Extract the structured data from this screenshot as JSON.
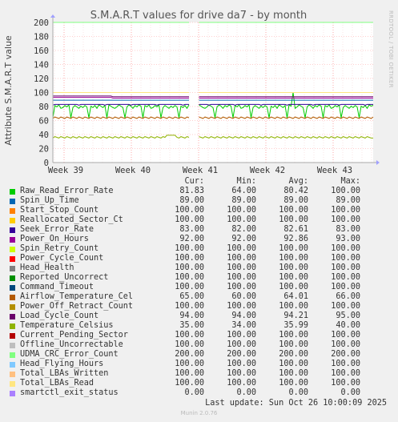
{
  "title": "S.M.A.R.T values for drive da7 - by month",
  "ylabel": "Attribute S.M.A.R.T value",
  "side_label": "RRDTOOL / TOBI OETIKER",
  "legend_header": {
    "cur": "Cur:",
    "min": "Min:",
    "avg": "Avg:",
    "max": "Max:"
  },
  "last_update": "Last update: Sun Oct 26 10:00:09 2025",
  "footer": "Munin 2.0.76",
  "chart_data": {
    "type": "line",
    "title": "S.M.A.R.T values for drive da7 - by month",
    "ylabel": "Attribute S.M.A.R.T value",
    "xlabel": "",
    "ylim": [
      0,
      200
    ],
    "yticks": [
      0,
      20,
      40,
      60,
      80,
      100,
      120,
      140,
      160,
      180,
      200
    ],
    "x_ticks": [
      "Week 39",
      "Week 40",
      "Week 41",
      "Week 42",
      "Week 43"
    ],
    "grid": true,
    "series": [
      {
        "name": "Raw_Read_Error_Rate",
        "color": "#00cc00",
        "cur": "81.83",
        "min": "64.00",
        "avg": "80.42",
        "max": "100.00"
      },
      {
        "name": "Spin_Up_Time",
        "color": "#0066b3",
        "cur": "89.00",
        "min": "89.00",
        "avg": "89.00",
        "max": "89.00"
      },
      {
        "name": "Start_Stop_Count",
        "color": "#ff8000",
        "cur": "100.00",
        "min": "100.00",
        "avg": "100.00",
        "max": "100.00"
      },
      {
        "name": "Reallocated_Sector_Ct",
        "color": "#ffcc00",
        "cur": "100.00",
        "min": "100.00",
        "avg": "100.00",
        "max": "100.00"
      },
      {
        "name": "Seek_Error_Rate",
        "color": "#330099",
        "cur": "83.00",
        "min": "82.00",
        "avg": "82.61",
        "max": "83.00"
      },
      {
        "name": "Power_On_Hours",
        "color": "#990099",
        "cur": "92.00",
        "min": "92.00",
        "avg": "92.86",
        "max": "93.00"
      },
      {
        "name": "Spin_Retry_Count",
        "color": "#ccff00",
        "cur": "100.00",
        "min": "100.00",
        "avg": "100.00",
        "max": "100.00"
      },
      {
        "name": "Power_Cycle_Count",
        "color": "#ff0000",
        "cur": "100.00",
        "min": "100.00",
        "avg": "100.00",
        "max": "100.00"
      },
      {
        "name": "Head_Health",
        "color": "#808080",
        "cur": "100.00",
        "min": "100.00",
        "avg": "100.00",
        "max": "100.00"
      },
      {
        "name": "Reported_Uncorrect",
        "color": "#008f00",
        "cur": "100.00",
        "min": "100.00",
        "avg": "100.00",
        "max": "100.00"
      },
      {
        "name": "Command_Timeout",
        "color": "#00487d",
        "cur": "100.00",
        "min": "100.00",
        "avg": "100.00",
        "max": "100.00"
      },
      {
        "name": "Airflow_Temperature_Cel",
        "color": "#b35a00",
        "cur": "65.00",
        "min": "60.00",
        "avg": "64.01",
        "max": "66.00"
      },
      {
        "name": "Power_Off_Retract_Count",
        "color": "#b38f00",
        "cur": "100.00",
        "min": "100.00",
        "avg": "100.00",
        "max": "100.00"
      },
      {
        "name": "Load_Cycle_Count",
        "color": "#6b006b",
        "cur": "94.00",
        "min": "94.00",
        "avg": "94.21",
        "max": "95.00"
      },
      {
        "name": "Temperature_Celsius",
        "color": "#8fb300",
        "cur": "35.00",
        "min": "34.00",
        "avg": "35.99",
        "max": "40.00"
      },
      {
        "name": "Current_Pending_Sector",
        "color": "#b30000",
        "cur": "100.00",
        "min": "100.00",
        "avg": "100.00",
        "max": "100.00"
      },
      {
        "name": "Offline_Uncorrectable",
        "color": "#bebebe",
        "cur": "100.00",
        "min": "100.00",
        "avg": "100.00",
        "max": "100.00"
      },
      {
        "name": "UDMA_CRC_Error_Count",
        "color": "#80ff80",
        "cur": "200.00",
        "min": "200.00",
        "avg": "200.00",
        "max": "200.00"
      },
      {
        "name": "Head_Flying_Hours",
        "color": "#80c9ff",
        "cur": "100.00",
        "min": "100.00",
        "avg": "100.00",
        "max": "100.00"
      },
      {
        "name": "Total_LBAs_Written",
        "color": "#ffc080",
        "cur": "100.00",
        "min": "100.00",
        "avg": "100.00",
        "max": "100.00"
      },
      {
        "name": "Total_LBAs_Read",
        "color": "#ffe680",
        "cur": "100.00",
        "min": "100.00",
        "avg": "100.00",
        "max": "100.00"
      },
      {
        "name": "smartctl_exit_status",
        "color": "#aa80ff",
        "cur": "0.00",
        "min": "0.00",
        "avg": "0.00",
        "max": "0.00"
      }
    ]
  }
}
